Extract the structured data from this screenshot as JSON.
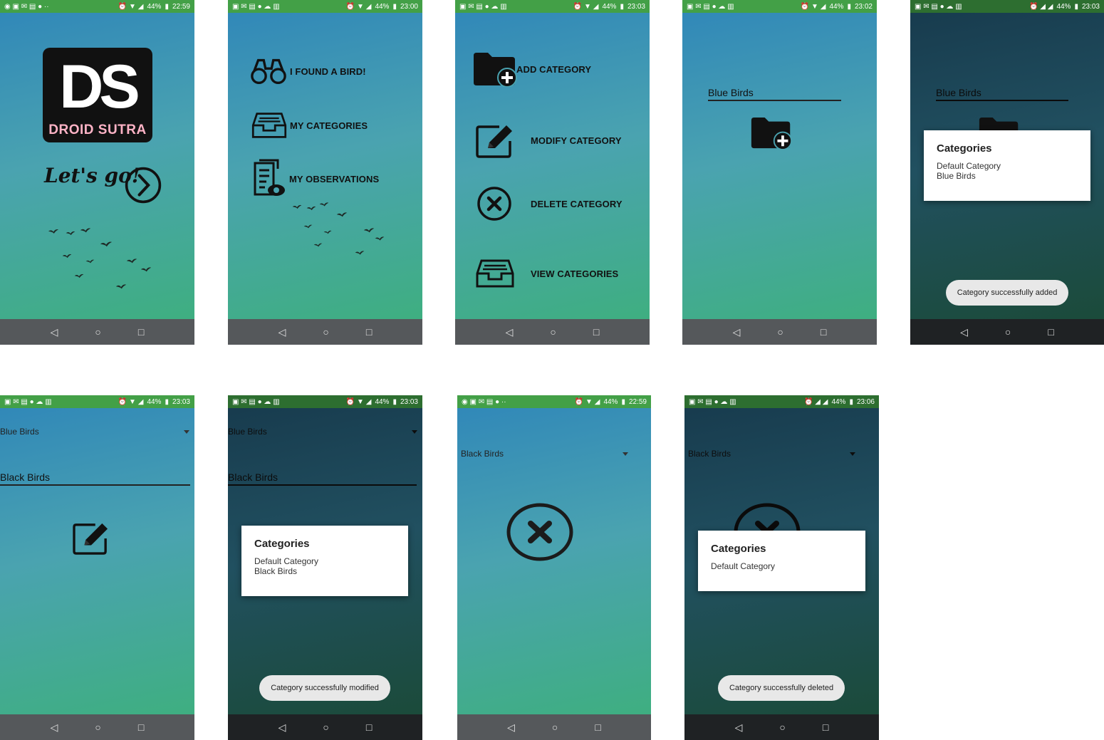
{
  "status": {
    "battery": "44%",
    "times": [
      "22:59",
      "23:00",
      "23:03",
      "23:02",
      "23:03",
      "23:03",
      "23:03",
      "22:59",
      "23:06"
    ]
  },
  "splash": {
    "logo_text": "DS",
    "logo_sub": "DROID SUTRA",
    "tagline": "Let's go!"
  },
  "home_menu": {
    "items": [
      {
        "label": "I FOUND A BIRD!",
        "icon": "binoculars-icon"
      },
      {
        "label": "MY CATEGORIES",
        "icon": "inbox-tray-icon"
      },
      {
        "label": "MY OBSERVATIONS",
        "icon": "document-eye-icon"
      }
    ]
  },
  "category_menu": {
    "items": [
      {
        "label": "ADD CATEGORY",
        "icon": "folder-add-icon"
      },
      {
        "label": "MODIFY CATEGORY",
        "icon": "edit-icon"
      },
      {
        "label": "DELETE CATEGORY",
        "icon": "close-circle-icon"
      },
      {
        "label": "VIEW CATEGORIES",
        "icon": "inbox-tray-icon"
      }
    ]
  },
  "add_screen": {
    "input_value": "Blue Birds"
  },
  "add_result": {
    "input_value": "Blue Birds",
    "dialog_title": "Categories",
    "dialog_items": [
      "Default Category",
      "Blue Birds"
    ],
    "toast": "Category successfully added"
  },
  "modify_screen": {
    "spinner_value": "Blue Birds",
    "input_value": "Black Birds"
  },
  "modify_result": {
    "spinner_value": "Blue Birds",
    "input_value": "Black Birds",
    "dialog_title": "Categories",
    "dialog_items": [
      "Default Category",
      "Black Birds"
    ],
    "toast": "Category successfully modified"
  },
  "delete_screen": {
    "spinner_value": "Black Birds"
  },
  "delete_result": {
    "spinner_value": "Black Birds",
    "dialog_title": "Categories",
    "dialog_items": [
      "Default Category"
    ],
    "toast": "Category successfully deleted"
  }
}
